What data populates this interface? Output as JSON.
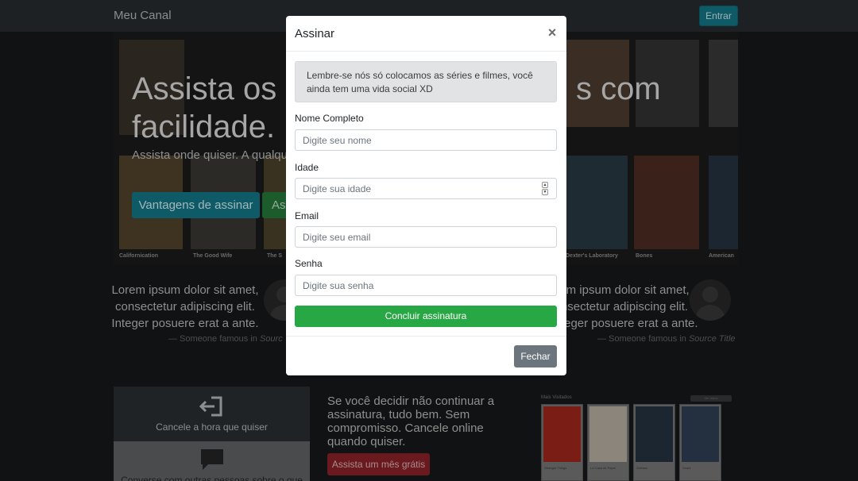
{
  "navbar": {
    "brand": "Meu Canal",
    "login_label": "Entrar"
  },
  "hero": {
    "title_left": "Assista os",
    "title_line2": "facilidade.",
    "title_right": "s com",
    "subtitle": "Assista onde quiser. A qualque",
    "benefits_button": "Vantagens de assinar",
    "subscribe_button": "As",
    "poster_captions": [
      "Californication",
      "The Good Wife",
      "The S",
      "Dexter's Laboratory",
      "Bones",
      "American"
    ],
    "poster_colors": [
      "#4b3a24",
      "#3d3a34",
      "#5a4a2e",
      "#2f3e4a",
      "#4a2a22",
      "#1f2f3a",
      "#3a3d42",
      "#463a30"
    ]
  },
  "quotes": {
    "left": {
      "text": "Lorem ipsum dolor sit amet, consectetur adipiscing elit. Integer posuere erat a ante.",
      "footer": "— Someone famous in",
      "source": "Sourc"
    },
    "right": {
      "text": "em ipsum dolor sit amet, nsectetur adipiscing elit. Integer posuere erat a ante.",
      "footer": "— Someone famous in",
      "source": "Source Title"
    }
  },
  "features": {
    "cancel_label": "Cancele a hora que quiser",
    "comment_label": "Converse com outras pessoas sobre o que"
  },
  "cancel_section": {
    "text": "Se você decidir não continuar a assinatura, tudo bem. Sem compromisso. Cancele online quando quiser.",
    "trial_button": "Assista um mês grátis"
  },
  "gallery": {
    "title": "Mais Visitados",
    "view_all": "Ver todos",
    "cards": [
      "Stranger Things",
      "La Casa de Papel",
      "Gotham",
      "Ozark"
    ],
    "card_colors": [
      "#7a1d14",
      "#c9c2b8",
      "#1b2630",
      "#24303f"
    ]
  },
  "modal": {
    "title": "Assinar",
    "close_glyph": "×",
    "notice": "Lembre-se nós só colocamos as séries e filmes, você ainda tem uma vida social XD",
    "fields": {
      "name": {
        "label": "Nome Completo",
        "placeholder": "Digite seu nome"
      },
      "age": {
        "label": "Idade",
        "placeholder": "Digite sua idade"
      },
      "email": {
        "label": "Email",
        "placeholder": "Digite seu email"
      },
      "password": {
        "label": "Senha",
        "placeholder": "Digite sua senha"
      }
    },
    "submit_label": "Concluir assinatura",
    "close_label": "Fechar"
  },
  "colors": {
    "overlay": "#000000",
    "success": "#28a745",
    "secondary": "#6c757d",
    "info": "#17a2b8",
    "danger": "#dc3545"
  }
}
